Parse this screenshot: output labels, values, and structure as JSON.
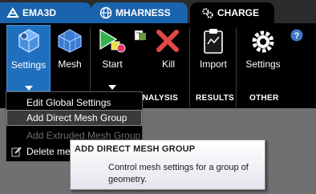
{
  "tabs": [
    {
      "label": "EMA3D",
      "icon": "ema3d-logo-icon",
      "active": false
    },
    {
      "label": "MHARNESS",
      "icon": "mharness-globe-icon",
      "active": false
    },
    {
      "label": "CHARGE",
      "icon": "charge-gears-icon",
      "active": true
    }
  ],
  "ribbon": {
    "settings_label": "Settings",
    "mesh_label": "Mesh",
    "start_label": "Start",
    "kill_label": "Kill",
    "import_label": "Import",
    "other_settings_label": "Settings",
    "groups": {
      "analysis": "ANALYSIS",
      "results": "RESULTS",
      "other": "OTHER"
    },
    "help_icon": "help-icon"
  },
  "dropdown": {
    "items": [
      {
        "label": "Edit Global Settings",
        "state": "normal"
      },
      {
        "label": "Add Direct Mesh Group",
        "state": "hover"
      },
      {
        "label": "Add Extruded Mesh Group",
        "state": "disabled"
      },
      {
        "label": "Delete me",
        "state": "normal"
      }
    ]
  },
  "tooltip": {
    "title": "ADD DIRECT MESH GROUP",
    "body": "Control mesh settings for a group of geometry."
  },
  "colors": {
    "tab_blue": "#1a63ad",
    "ribbon_bg": "#000000",
    "selected_blue": "#1f6fbf",
    "workspace": "#707070"
  }
}
